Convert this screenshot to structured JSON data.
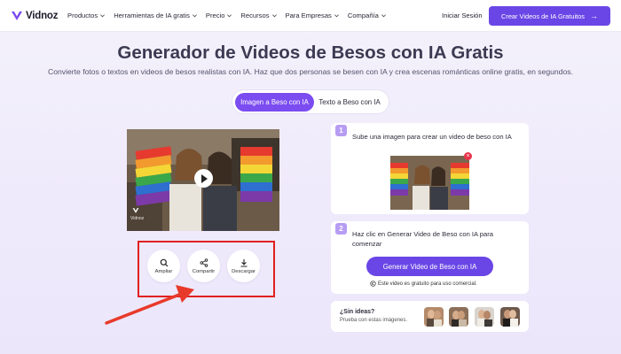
{
  "nav": {
    "logo_text": "Vidnoz",
    "menu": [
      {
        "label": "Productos"
      },
      {
        "label": "Herramientas de IA gratis"
      },
      {
        "label": "Precio"
      },
      {
        "label": "Recursos"
      },
      {
        "label": "Para Empresas"
      },
      {
        "label": "Compañía"
      }
    ],
    "login_label": "Iniciar Sesión",
    "cta_label": "Crear Videos de IA Gratuitos",
    "cta_arrow": "→"
  },
  "hero": {
    "title": "Generador de Videos de Besos con IA Gratis",
    "subtitle": "Convierte fotos o textos en videos de besos realistas con IA. Haz que dos personas se besen con IA y crea escenas románticas online gratis, en segundos."
  },
  "tabs": [
    {
      "label": "Imagen a Beso con IA",
      "active": true
    },
    {
      "label": "Texto a Beso con IA",
      "active": false
    }
  ],
  "preview": {
    "watermark": "Vidnoz",
    "actions": [
      {
        "label": "Ampliar",
        "icon": "search-icon"
      },
      {
        "label": "Compartir",
        "icon": "share-icon"
      },
      {
        "label": "Descargar",
        "icon": "download-icon"
      }
    ]
  },
  "steps": [
    {
      "number": "1",
      "text": "Sube una imagen para crear un video de beso con IA",
      "remove_icon": "×"
    },
    {
      "number": "2",
      "text": "Haz clic en Generar Video de Beso con IA para comenzar",
      "button_label": "Generar Video de Beso con IA",
      "note": "Este video es gratuito para uso comercial."
    }
  ],
  "ideas": {
    "title": "¿Sin ideas?",
    "subtitle": "Prueba con estas imágenes."
  },
  "colors": {
    "accent": "#6a46e6",
    "tab_active": "#7b4cf0",
    "step_badge": "#b79cf3",
    "highlight_red": "#e02020"
  }
}
